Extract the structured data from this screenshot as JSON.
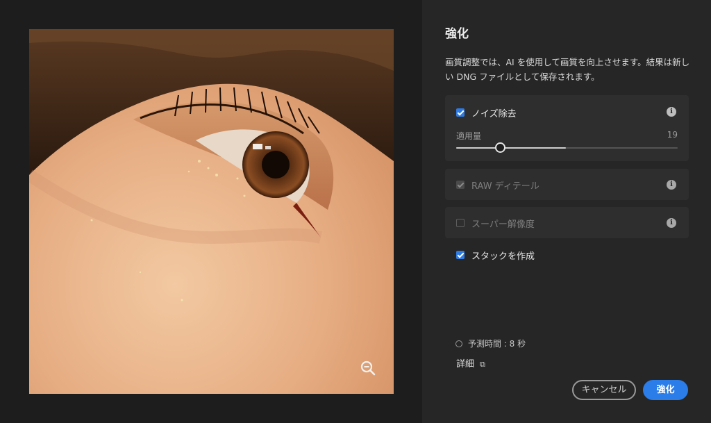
{
  "preview": {
    "zoom_icon": "zoom-out-icon",
    "image_subject": "close-up-eye-photo"
  },
  "panel": {
    "title": "強化",
    "description": "画質調整では、AI を使用して画質を向上させます。結果は新しい DNG ファイルとして保存されます。",
    "options": {
      "noise": {
        "label": "ノイズ除去",
        "checked": true,
        "enabled": true,
        "amount_label": "適用量",
        "amount_value": "19",
        "slider_fraction": 0.19
      },
      "raw": {
        "label": "RAW ディテール",
        "checked": true,
        "enabled": false
      },
      "super": {
        "label": "スーパー解像度",
        "checked": false,
        "enabled": false
      },
      "stack": {
        "label": "スタックを作成",
        "checked": true
      }
    },
    "estimate": "予測時間 : 8 秒",
    "details_link": "詳細",
    "buttons": {
      "cancel": "キャンセル",
      "enhance": "強化"
    },
    "colors": {
      "accent": "#2b7de9",
      "panel_bg": "#262626",
      "card_bg": "#2e2e2e"
    }
  }
}
